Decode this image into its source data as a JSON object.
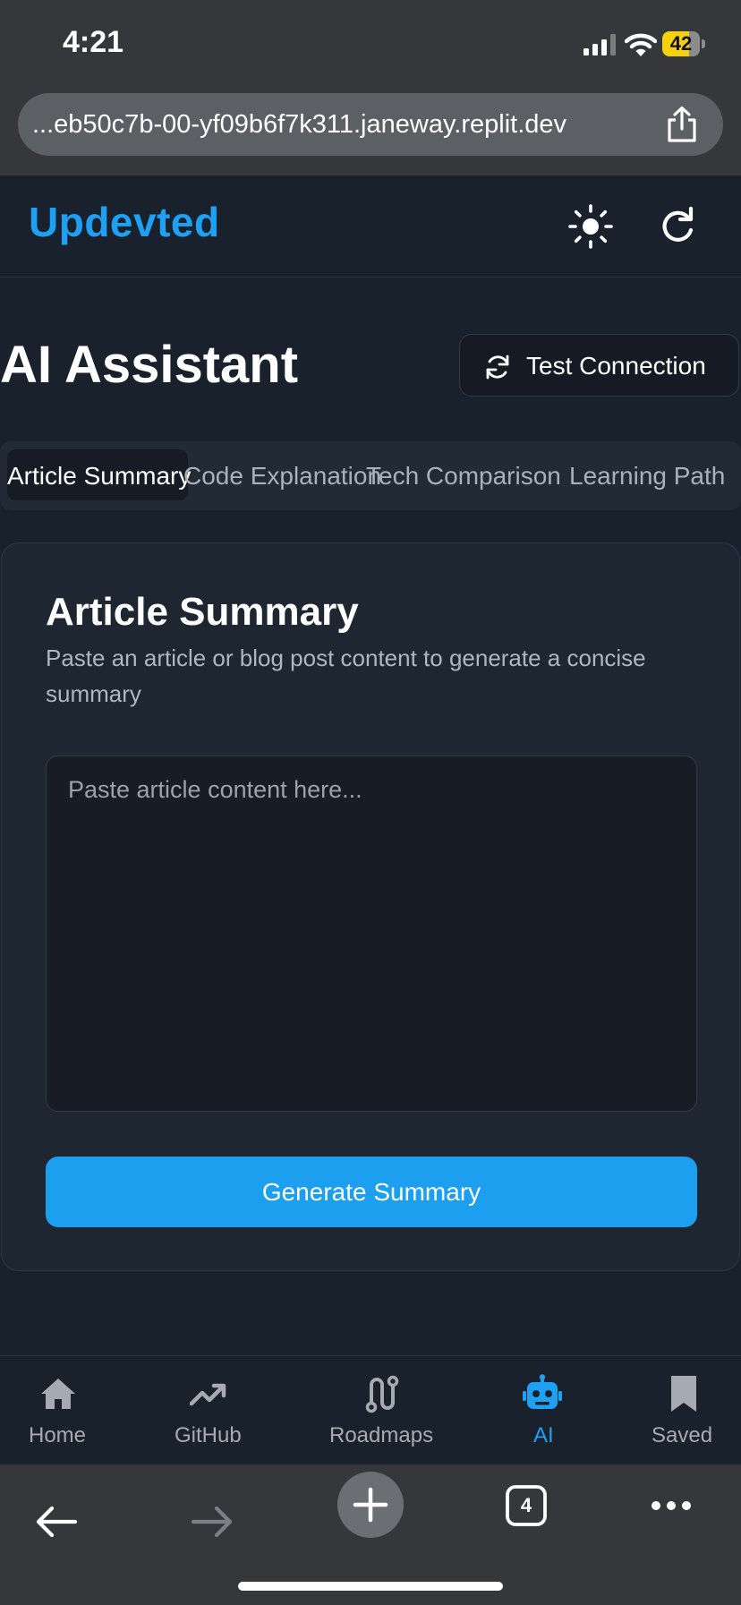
{
  "status_bar": {
    "time": "4:21",
    "battery": "42"
  },
  "browser": {
    "url": "...eb50c7b-00-yf09b6f7k311.janeway.replit.dev",
    "tab_count": "4"
  },
  "header": {
    "brand": "Updevted"
  },
  "page": {
    "title": "AI Assistant",
    "test_connection_label": "Test Connection"
  },
  "tabs": [
    {
      "label": "Article Summary",
      "active": true
    },
    {
      "label": "Code Explanation",
      "active": false
    },
    {
      "label": "Tech Comparison",
      "active": false
    },
    {
      "label": "Learning Path",
      "active": false
    }
  ],
  "card": {
    "title": "Article Summary",
    "description": "Paste an article or blog post content to generate a concise summary",
    "input_placeholder": "Paste article content here...",
    "input_value": "",
    "button_label": "Generate Summary"
  },
  "bottom_nav": [
    {
      "label": "Home",
      "icon": "home-icon",
      "active": false
    },
    {
      "label": "GitHub",
      "icon": "trending-icon",
      "active": false
    },
    {
      "label": "Roadmaps",
      "icon": "route-icon",
      "active": false
    },
    {
      "label": "AI",
      "icon": "robot-icon",
      "active": true
    },
    {
      "label": "Saved",
      "icon": "bookmark-icon",
      "active": false
    }
  ],
  "colors": {
    "accent": "#1ea1f2",
    "background": "#19212c",
    "card": "#1e2632",
    "battery": "#f4d10b"
  }
}
